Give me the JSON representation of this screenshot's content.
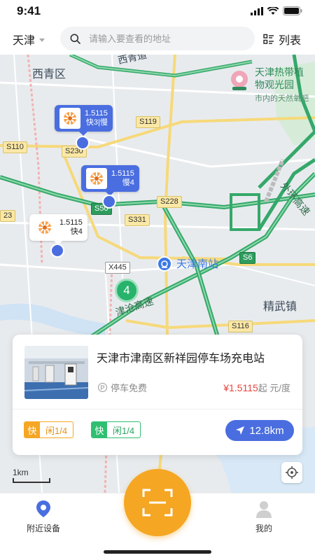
{
  "status_bar": {
    "time": "9:41"
  },
  "header": {
    "city": "天津",
    "search_placeholder": "请输入要查看的地址",
    "list_label": "列表"
  },
  "map": {
    "places": {
      "xiqing": "西青区",
      "park_line1": "天津热带植",
      "park_line2": "物观光园",
      "park_sub": "市内的天然氧吧",
      "south_station": "天津南站",
      "jingwu": "精武镇",
      "expressway": "津沧高速",
      "ring": "外环高速",
      "xiqing_dao": "西青道"
    },
    "road_labels": {
      "s119": "S119",
      "s110": "S110",
      "s230": "S230",
      "s50": "S50",
      "s228": "S228",
      "s331": "S331",
      "x445": "X445",
      "s6": "S6",
      "s116": "S116",
      "edge_23": "23"
    },
    "markers": [
      {
        "price": "1.5115",
        "detail": "快3|慢",
        "style": "blue"
      },
      {
        "price": "1.5115",
        "detail": "慢4",
        "style": "blue"
      },
      {
        "price": "1.5115",
        "detail": "快4",
        "style": "white"
      }
    ],
    "cluster_count": "4",
    "scale_label": "1km"
  },
  "station_card": {
    "title": "天津市津南区新祥园停车场充电站",
    "parking_icon": "P",
    "parking": "停车免费",
    "price_prefix": "¥",
    "price_value": "1.5115",
    "price_suffix": "起 元/度",
    "tags": [
      {
        "kind": "快",
        "status": "闲1/4",
        "color": "#f5a623"
      },
      {
        "kind": "快",
        "status": "闲1/4",
        "color": "#2fbf71"
      }
    ],
    "distance": "12.8km"
  },
  "bottom_nav": {
    "nearby": "附近设备",
    "mine": "我的"
  },
  "colors": {
    "accent_blue": "#4a6ee0",
    "scan_orange": "#f5a623",
    "price_red": "#e8453c",
    "fast_green": "#2fbf71"
  },
  "icons": [
    "search-icon",
    "list-icon",
    "location-pin-icon",
    "scan-icon",
    "user-icon",
    "navigate-arrow-icon",
    "locate-icon",
    "charging-logo-icon"
  ]
}
